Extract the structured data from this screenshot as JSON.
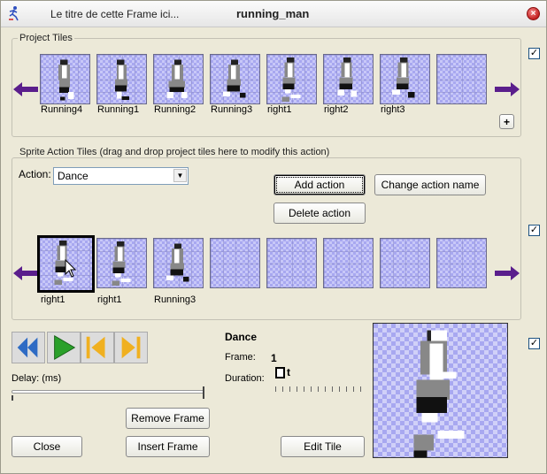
{
  "window": {
    "title_left": "Le titre de cette Frame ici...",
    "title_main": "running_man",
    "close_glyph": "×"
  },
  "project_tiles": {
    "group_label": "Project Tiles",
    "tiles": [
      {
        "label": "Running4",
        "pose": "run4"
      },
      {
        "label": "Running1",
        "pose": "run1"
      },
      {
        "label": "Running2",
        "pose": "run2"
      },
      {
        "label": "Running3",
        "pose": "run3"
      },
      {
        "label": "right1",
        "pose": "right1"
      },
      {
        "label": "right2",
        "pose": "right2"
      },
      {
        "label": "right3",
        "pose": "right3"
      },
      {
        "label": "",
        "pose": "empty"
      }
    ],
    "add_label": "+",
    "checkbox_checked": true
  },
  "action": {
    "group_label": "Sprite Action Tiles (drag and drop project tiles here to modify this action)",
    "label": "Action:",
    "selected": "Dance",
    "add_button": "Add action",
    "change_button": "Change action name",
    "delete_button": "Delete action",
    "checkbox_checked": true,
    "tiles": [
      {
        "label": "right1",
        "pose": "right1",
        "selected": true
      },
      {
        "label": "right1",
        "pose": "right1"
      },
      {
        "label": "Running3",
        "pose": "run3"
      },
      {
        "label": "",
        "pose": "empty"
      },
      {
        "label": "",
        "pose": "empty"
      },
      {
        "label": "",
        "pose": "empty"
      },
      {
        "label": "",
        "pose": "empty"
      },
      {
        "label": "",
        "pose": "empty"
      }
    ]
  },
  "player": {
    "delay_label": "Delay: (ms)",
    "remove_frame": "Remove Frame",
    "insert_frame": "Insert Frame",
    "close": "Close",
    "edit_tile": "Edit Tile",
    "action_name": "Dance",
    "frame_label": "Frame:",
    "frame_value": "1",
    "duration_label": "Duration:",
    "duration_suffix": "t",
    "preview_checkbox_checked": true
  },
  "colors": {
    "arrow": "#5a1e8c",
    "play": "#2aa02a",
    "rewind": "#2e6bc4",
    "step": "#f0b020"
  }
}
